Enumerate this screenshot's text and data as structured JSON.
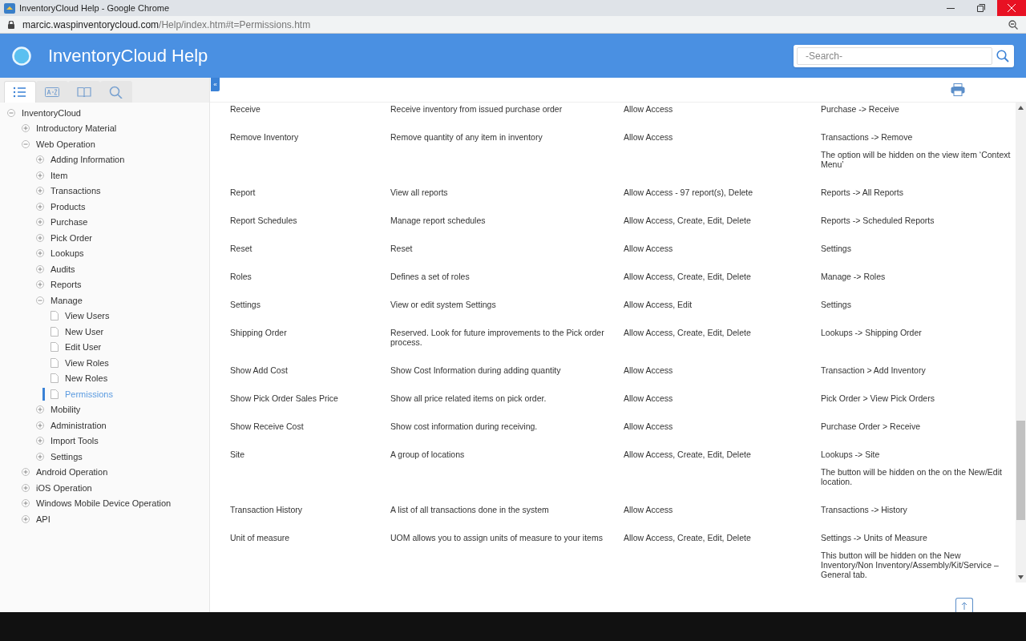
{
  "window": {
    "title": "InventoryCloud Help - Google Chrome"
  },
  "address_bar": {
    "url_host": "marcic.waspinventorycloud.com",
    "url_path": "/Help/index.htm#t=Permissions.htm"
  },
  "header": {
    "title": "InventoryCloud Help",
    "search": {
      "placeholder": "-Search-"
    }
  },
  "sidebar": {
    "tabs": [
      {
        "kind": "toc",
        "selected": true
      },
      {
        "kind": "index",
        "selected": false
      },
      {
        "kind": "glossary",
        "selected": false
      },
      {
        "kind": "search",
        "selected": false
      }
    ],
    "collapse_button": "«",
    "tree": [
      {
        "label": "InventoryCloud",
        "kind": "folder",
        "expanded": true,
        "children": [
          {
            "label": "Introductory Material",
            "kind": "folder",
            "expanded": false
          },
          {
            "label": "Web Operation",
            "kind": "folder",
            "expanded": true,
            "children": [
              {
                "label": "Adding Information",
                "kind": "folder",
                "expanded": false
              },
              {
                "label": "Item",
                "kind": "folder",
                "expanded": false
              },
              {
                "label": "Transactions",
                "kind": "folder",
                "expanded": false
              },
              {
                "label": "Products",
                "kind": "folder",
                "expanded": false
              },
              {
                "label": "Purchase",
                "kind": "folder",
                "expanded": false
              },
              {
                "label": "Pick Order",
                "kind": "folder",
                "expanded": false
              },
              {
                "label": "Lookups",
                "kind": "folder",
                "expanded": false
              },
              {
                "label": "Audits",
                "kind": "folder",
                "expanded": false
              },
              {
                "label": "Reports",
                "kind": "folder",
                "expanded": false
              },
              {
                "label": "Manage",
                "kind": "folder",
                "expanded": true,
                "children": [
                  {
                    "label": "View Users",
                    "kind": "page",
                    "selected": false
                  },
                  {
                    "label": "New User",
                    "kind": "page",
                    "selected": false
                  },
                  {
                    "label": "Edit User",
                    "kind": "page",
                    "selected": false
                  },
                  {
                    "label": "View Roles",
                    "kind": "page",
                    "selected": false
                  },
                  {
                    "label": "New Roles",
                    "kind": "page",
                    "selected": false
                  },
                  {
                    "label": "Permissions",
                    "kind": "page",
                    "selected": true
                  }
                ]
              },
              {
                "label": "Mobility",
                "kind": "folder",
                "expanded": false
              },
              {
                "label": "Administration",
                "kind": "folder",
                "expanded": false
              },
              {
                "label": "Import Tools",
                "kind": "folder",
                "expanded": false
              },
              {
                "label": "Settings",
                "kind": "folder",
                "expanded": false
              }
            ]
          },
          {
            "label": "Android Operation",
            "kind": "folder",
            "expanded": false
          },
          {
            "label": "iOS Operation",
            "kind": "folder",
            "expanded": false
          },
          {
            "label": "Windows Mobile Device Operation",
            "kind": "folder",
            "expanded": false
          },
          {
            "label": "API",
            "kind": "folder",
            "expanded": false
          }
        ]
      }
    ]
  },
  "table": {
    "rows": [
      {
        "permission": "Receive",
        "description": "Receive inventory from issued purchase order",
        "access": "Allow Access",
        "location": [
          "Purchase -> Receive"
        ]
      },
      {
        "permission": "Remove Inventory",
        "description": "Remove quantity of any item in inventory",
        "access": "Allow Access",
        "location": [
          "Transactions -> Remove",
          "The option will be hidden on the view item ‘Context Menu’"
        ]
      },
      {
        "permission": "Report",
        "description": "View all reports",
        "access": "Allow Access - 97 report(s), Delete",
        "location": [
          "Reports -> All Reports"
        ]
      },
      {
        "permission": "Report Schedules",
        "description": "Manage report schedules",
        "access": "Allow Access, Create, Edit, Delete",
        "location": [
          "Reports -> Scheduled Reports"
        ]
      },
      {
        "permission": "Reset",
        "description": "Reset",
        "access": "Allow Access",
        "location": [
          "Settings"
        ]
      },
      {
        "permission": "Roles",
        "description": "Defines a set of roles",
        "access": "Allow Access, Create, Edit, Delete",
        "location": [
          "Manage -> Roles"
        ]
      },
      {
        "permission": "Settings",
        "description": "View or edit system Settings",
        "access": "Allow Access, Edit",
        "location": [
          "Settings"
        ]
      },
      {
        "permission": "Shipping Order",
        "description": "Reserved. Look for future improvements to the Pick order process.",
        "access": "Allow Access, Create, Edit, Delete",
        "location": [
          "Lookups -> Shipping Order"
        ]
      },
      {
        "permission": "Show Add Cost",
        "description": "Show Cost Information during adding quantity",
        "access": "Allow Access",
        "location": [
          "Transaction > Add Inventory"
        ]
      },
      {
        "permission": "Show Pick Order Sales Price",
        "description": "Show all price related items on pick order.",
        "access": "Allow Access",
        "location": [
          "Pick Order > View Pick Orders"
        ]
      },
      {
        "permission": "Show Receive Cost",
        "description": "Show cost information during receiving.",
        "access": "Allow Access",
        "location": [
          "Purchase Order > Receive"
        ]
      },
      {
        "permission": "Site",
        "description": "A group of locations",
        "access": "Allow Access, Create, Edit, Delete",
        "location": [
          "Lookups -> Site",
          "The button will be hidden on the on the New/Edit location."
        ]
      },
      {
        "permission": "Transaction History",
        "description": "A list of all transactions done in the system",
        "access": "Allow Access",
        "location": [
          "Transactions -> History"
        ]
      },
      {
        "permission": "Unit of measure",
        "description": "UOM allows you to assign units of measure to your items",
        "access": "Allow Access, Create, Edit, Delete",
        "location": [
          "Settings -> Units of Measure",
          "This button will be hidden on the New Inventory/Non Inventory/Assembly/Kit/Service – General tab."
        ]
      }
    ]
  }
}
